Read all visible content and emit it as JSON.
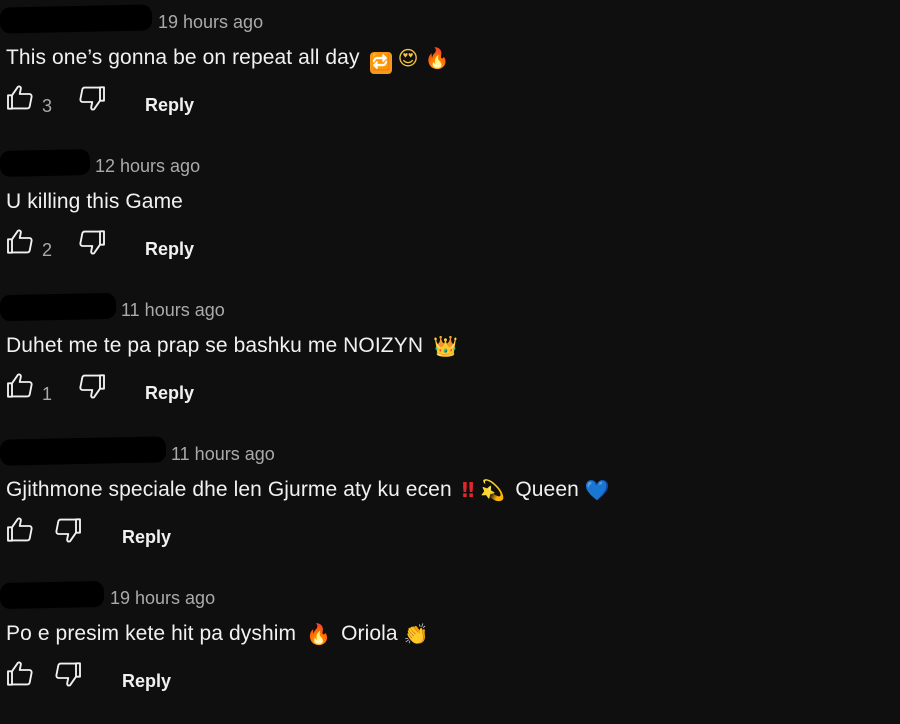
{
  "comments": [
    {
      "time": "19 hours ago",
      "text": "This one’s gonna be on repeat all day",
      "emojis": [
        "🔁",
        "😍",
        "🔥"
      ],
      "likes": "3",
      "reply_label": "Reply"
    },
    {
      "time": "12 hours ago",
      "text": "U killing this Game",
      "emojis": [],
      "likes": "2",
      "reply_label": "Reply"
    },
    {
      "time": "11 hours ago",
      "text": "Duhet me te pa prap se bashku me NOIZYN",
      "emojis": [
        "👑"
      ],
      "likes": "1",
      "reply_label": "Reply"
    },
    {
      "time": "11 hours ago",
      "text": "Gjithmone speciale dhe len Gjurme aty ku ecen",
      "emojis": [
        "‼",
        "💫"
      ],
      "text_after": "Queen",
      "emoji_after": "💙",
      "likes": "",
      "reply_label": "Reply"
    },
    {
      "time": "19 hours ago",
      "text": "Po e presim kete hit pa dyshim",
      "emojis": [
        "🔥"
      ],
      "text_after": "Oriola",
      "emoji_after": "👏",
      "likes": "",
      "reply_label": "Reply"
    }
  ],
  "colors": {
    "background": "#0f0f0f",
    "text": "#f1f1f1",
    "muted": "#aaaaaa"
  },
  "icons": {
    "like": "thumbs-up-icon",
    "dislike": "thumbs-down-icon"
  }
}
